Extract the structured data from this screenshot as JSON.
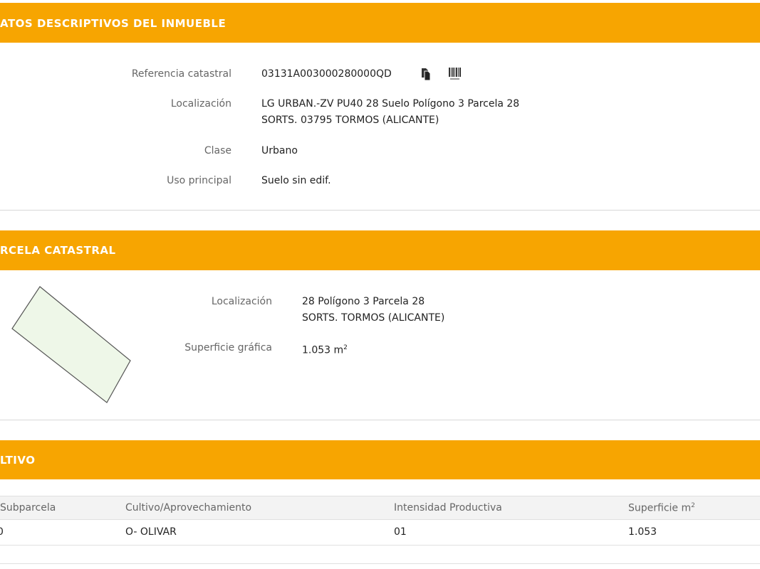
{
  "datos": {
    "title": "ATOS DESCRIPTIVOS DEL INMUEBLE",
    "referencia_label": "Referencia catastral",
    "referencia_value": "03131A003000280000QD",
    "localizacion_label": "Localización",
    "localizacion_line1": "LG URBAN.-ZV PU40 28 Suelo Polígono 3 Parcela 28",
    "localizacion_line2": "SORTS. 03795 TORMOS (ALICANTE)",
    "clase_label": "Clase",
    "clase_value": "Urbano",
    "uso_label": "Uso principal",
    "uso_value": "Suelo sin edif.",
    "copy_icon": "copy-document-icon",
    "barcode_icon": "barcode-icon"
  },
  "parcela": {
    "title": "RCELA CATASTRAL",
    "localizacion_label": "Localización",
    "localizacion_line1": "28 Polígono 3 Parcela 28",
    "localizacion_line2": "SORTS. TORMOS (ALICANTE)",
    "superficie_label": "Superficie gráfica",
    "superficie_value": "1.053 m",
    "superficie_unit_sup": "2"
  },
  "cultivo": {
    "title": "LTIVO",
    "headers": {
      "subparcela": "Subparcela",
      "cultivo": "Cultivo/Aprovechamiento",
      "intensidad": "Intensidad Productiva",
      "superficie": "Superficie m",
      "superficie_sup": "2"
    },
    "rows": [
      {
        "subparcela": "0",
        "cultivo": "O- OLIVAR",
        "intensidad": "01",
        "superficie": "1.053"
      }
    ]
  },
  "colors": {
    "header_orange": "#f7a501",
    "parcel_fill": "#eef7e8",
    "parcel_stroke": "#555555"
  }
}
